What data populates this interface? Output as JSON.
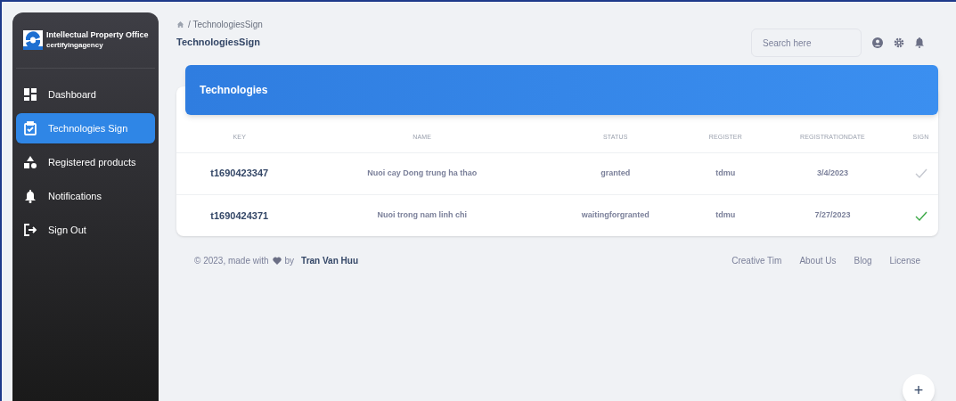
{
  "sidebar": {
    "brand": {
      "title": "Intellectual Property Office",
      "subtitle": "certifyingagency"
    },
    "items": [
      {
        "kind": "dashboard",
        "label": "Dashboard",
        "selected": false
      },
      {
        "kind": "clipboard",
        "label": "Technologies Sign",
        "selected": true
      },
      {
        "kind": "shapes",
        "label": "Registered products",
        "selected": false
      },
      {
        "kind": "bell",
        "label": "Notifications",
        "selected": false
      },
      {
        "kind": "logout",
        "label": "Sign Out",
        "selected": false
      }
    ]
  },
  "header": {
    "breadcrumb": "/ TechnologiesSign",
    "title": "TechnologiesSign",
    "search": {
      "placeholder": "Search here"
    }
  },
  "card": {
    "title": "Technologies",
    "table": {
      "columns": [
        "KEY",
        "NAME",
        "STATUS",
        "REGISTER",
        "REGISTRATIONDATE",
        "SIGN"
      ],
      "rows": [
        {
          "key": "t1690423347",
          "name": "Nuoi cay Dong trung ha thao",
          "status": "granted",
          "register": "tdmu",
          "date": "3/4/2023",
          "signed": false
        },
        {
          "key": "t1690424371",
          "name": "Nuoi trong nam linh chi",
          "status": "waitingforgranted",
          "register": "tdmu",
          "date": "7/27/2023",
          "signed": true
        }
      ]
    }
  },
  "footer": {
    "credit_before": "© 2023, made with",
    "credit_by": "by",
    "author": "Tran Van Huu",
    "links": [
      "Creative Tim",
      "About Us",
      "Blog",
      "License"
    ]
  },
  "fab": "+"
}
